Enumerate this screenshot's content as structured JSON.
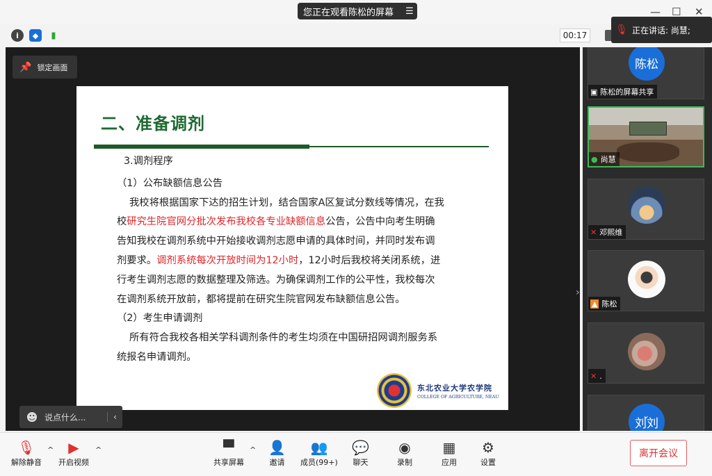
{
  "banner": {
    "text": "您正在观看陈松的屏幕",
    "menu_icon": "list-icon"
  },
  "window": {
    "minimize": "—",
    "maximize": "☐",
    "close": "✕"
  },
  "timer": "00:17",
  "speaking": {
    "label": "正在讲话: 尚慧;"
  },
  "share": {
    "lock_label": "锁定画面",
    "slide": {
      "title": "二、准备调剂",
      "lines": [
        {
          "a": "3.调剂程序",
          "b": "",
          "c": ""
        },
        {
          "a": "",
          "b": "",
          "c": ""
        },
        {
          "a": "（1）公布缺额信息公告",
          "b": "",
          "c": ""
        },
        {
          "a": "我校将根据国家下达的招生计划，结合国家A区复试分数线等情况，在我",
          "b": "",
          "c": ""
        },
        {
          "a": "校",
          "b": "研究生院官网分批次发布我校各专业缺额信息",
          "c": "公告，公告中向考生明确"
        },
        {
          "a": "告知我校在调剂系统中开始接收调剂志愿申请的具体时间，并同时发布调",
          "b": "",
          "c": ""
        },
        {
          "a": "剂要求。",
          "b": "调剂系统每次开放时间为12小时",
          "c": "，12小时后我校将关闭系统，进"
        },
        {
          "a": "行考生调剂志愿的数据整理及筛选。为确保调剂工作的公平性，我校每次",
          "b": "",
          "c": ""
        },
        {
          "a": "在调剂系统开放前，都将提前在研究生院官网发布缺额信息公告。",
          "b": "",
          "c": ""
        },
        {
          "a": "（2）考生申请调剂",
          "b": "",
          "c": ""
        },
        {
          "a": "所有符合我校各相关学科调剂条件的考生均须在中国研招网调剂服务系",
          "b": "",
          "c": ""
        },
        {
          "a": "统报名申请调剂。",
          "b": "",
          "c": ""
        }
      ],
      "logo_cn": "东北农业大学农学院",
      "logo_en": "COLLEGE OF AGRICULTURE, NEAU"
    },
    "chat_placeholder": "说点什么...",
    "chat_collapse": "‹"
  },
  "participants": [
    {
      "avatar_text": "陈松",
      "label": "陈松的屏幕共享",
      "icon": "screen-share-icon"
    },
    {
      "label": "尚慧",
      "icon": "mic-active-icon"
    },
    {
      "label": "邓熙维",
      "icon": "mic-muted-icon"
    },
    {
      "label": "陈松",
      "icon": "host-icon"
    },
    {
      "label": ".",
      "icon": "mic-muted-icon"
    },
    {
      "avatar_text": "刘刘"
    }
  ],
  "toolbar": {
    "mute": "解除静音",
    "video": "开启视频",
    "share": "共享屏幕",
    "invite": "邀请",
    "members": "成员(99+)",
    "chat": "聊天",
    "record": "录制",
    "apps": "应用",
    "settings": "设置",
    "leave": "离开会议"
  },
  "colors": {
    "accent": "#1a6ed8",
    "leave": "#e03030",
    "slide_title": "#1e6a32",
    "highlight": "#e0262a"
  }
}
